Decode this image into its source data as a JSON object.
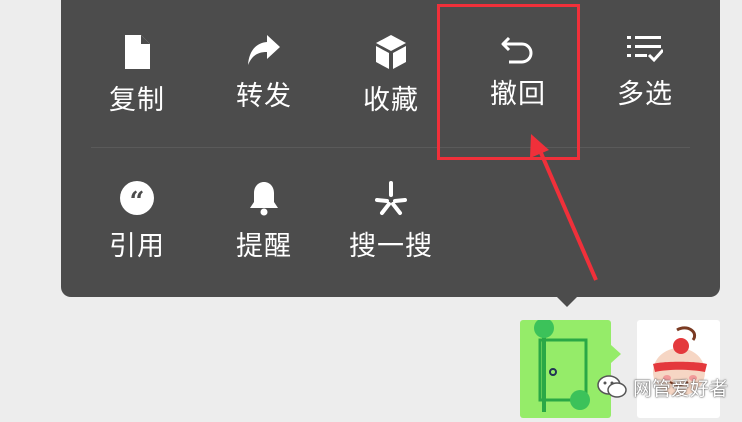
{
  "context_menu": {
    "items": [
      {
        "label": "复制",
        "icon": "document-icon"
      },
      {
        "label": "转发",
        "icon": "forward-arrow-icon"
      },
      {
        "label": "收藏",
        "icon": "cube-icon"
      },
      {
        "label": "撤回",
        "icon": "undo-icon"
      },
      {
        "label": "多选",
        "icon": "checklist-icon"
      },
      {
        "label": "引用",
        "icon": "quote-icon"
      },
      {
        "label": "提醒",
        "icon": "bell-icon"
      },
      {
        "label": "搜一搜",
        "icon": "search-spark-icon"
      }
    ],
    "highlighted_item": "撤回"
  },
  "watermark": {
    "text": "网管爱好者",
    "icon": "wechat-icon"
  },
  "colors": {
    "menu_bg": "#4c4c4c",
    "bubble_green": "#95ec69",
    "highlight_red": "#f0303a",
    "page_bg": "#ededed"
  }
}
